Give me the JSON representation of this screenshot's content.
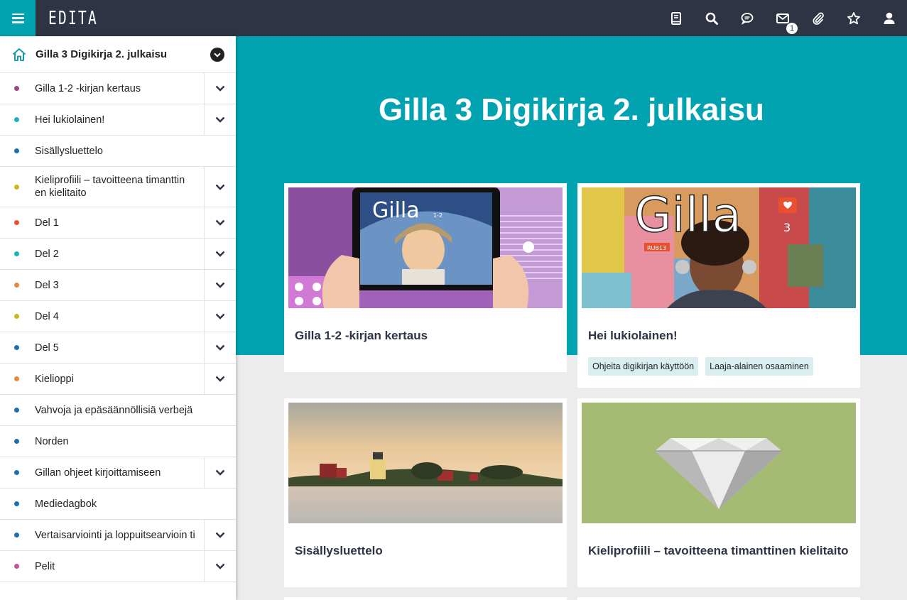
{
  "app": {
    "logo": "EDITA"
  },
  "topbar": {
    "icons": [
      {
        "name": "book-icon"
      },
      {
        "name": "search-icon"
      },
      {
        "name": "chat-icon"
      },
      {
        "name": "mail-icon",
        "badge": "1"
      },
      {
        "name": "paperclip-icon"
      },
      {
        "name": "star-icon"
      },
      {
        "name": "user-icon"
      }
    ]
  },
  "sidebar": {
    "header": "Gilla 3 Digikirja 2. julkaisu",
    "items": [
      {
        "label": "Gilla 1-2 -kirjan kertaus",
        "color": "#a0427e",
        "expandable": true
      },
      {
        "label": "Hei lukiolainen!",
        "color": "#1fb2b5",
        "expandable": true
      },
      {
        "label": "Sisällysluettelo",
        "color": "#1e6fb0",
        "expandable": false
      },
      {
        "label": "Kieliprofiili – tavoitteena timanttin en kielitaito",
        "color": "#c8b820",
        "expandable": true
      },
      {
        "label": "Del 1",
        "color": "#e8502e",
        "expandable": true
      },
      {
        "label": "Del 2",
        "color": "#1fb2b5",
        "expandable": true
      },
      {
        "label": "Del 3",
        "color": "#e08c3c",
        "expandable": true
      },
      {
        "label": "Del 4",
        "color": "#c8b820",
        "expandable": true
      },
      {
        "label": "Del 5",
        "color": "#1e6fb0",
        "expandable": true
      },
      {
        "label": "Kielioppi",
        "color": "#e08c3c",
        "expandable": true
      },
      {
        "label": "Vahvoja ja epäsäännöllisiä verbejä",
        "color": "#1e6fb0",
        "expandable": false
      },
      {
        "label": "Norden",
        "color": "#1e6fb0",
        "expandable": false
      },
      {
        "label": "Gillan ohjeet kirjoittamiseen",
        "color": "#1e6fb0",
        "expandable": true
      },
      {
        "label": "Mediedagbok",
        "color": "#1e6fb0",
        "expandable": false
      },
      {
        "label": "Vertaisarviointi ja loppuitsearvioin ti",
        "color": "#1e6fb0",
        "expandable": true
      },
      {
        "label": "Pelit",
        "color": "#c0509a",
        "expandable": true
      }
    ]
  },
  "main": {
    "title": "Gilla 3 Digikirja 2. julkaisu",
    "cards": [
      {
        "title": "Gilla 1-2 -kirjan kertaus",
        "image": "tablet-cover-image",
        "tags": []
      },
      {
        "title": "Hei lukiolainen!",
        "image": "student-headphones-image",
        "tags": [
          "Ohjeita digikirjan käyttöön",
          "Laaja-alainen osaaminen"
        ]
      },
      {
        "title": "Sisällysluettelo",
        "image": "lighthouse-island-image",
        "tags": []
      },
      {
        "title": "Kieliprofiili – tavoitteena timanttinen kielitaito",
        "image": "diamond-image",
        "tags": []
      }
    ],
    "covers": {
      "gilla12_logo": "Gilla",
      "gilla12_num": "1-2",
      "gilla3_logo": "Gilla",
      "gilla3_num": "3",
      "gilla3_code": "RUB13"
    }
  }
}
